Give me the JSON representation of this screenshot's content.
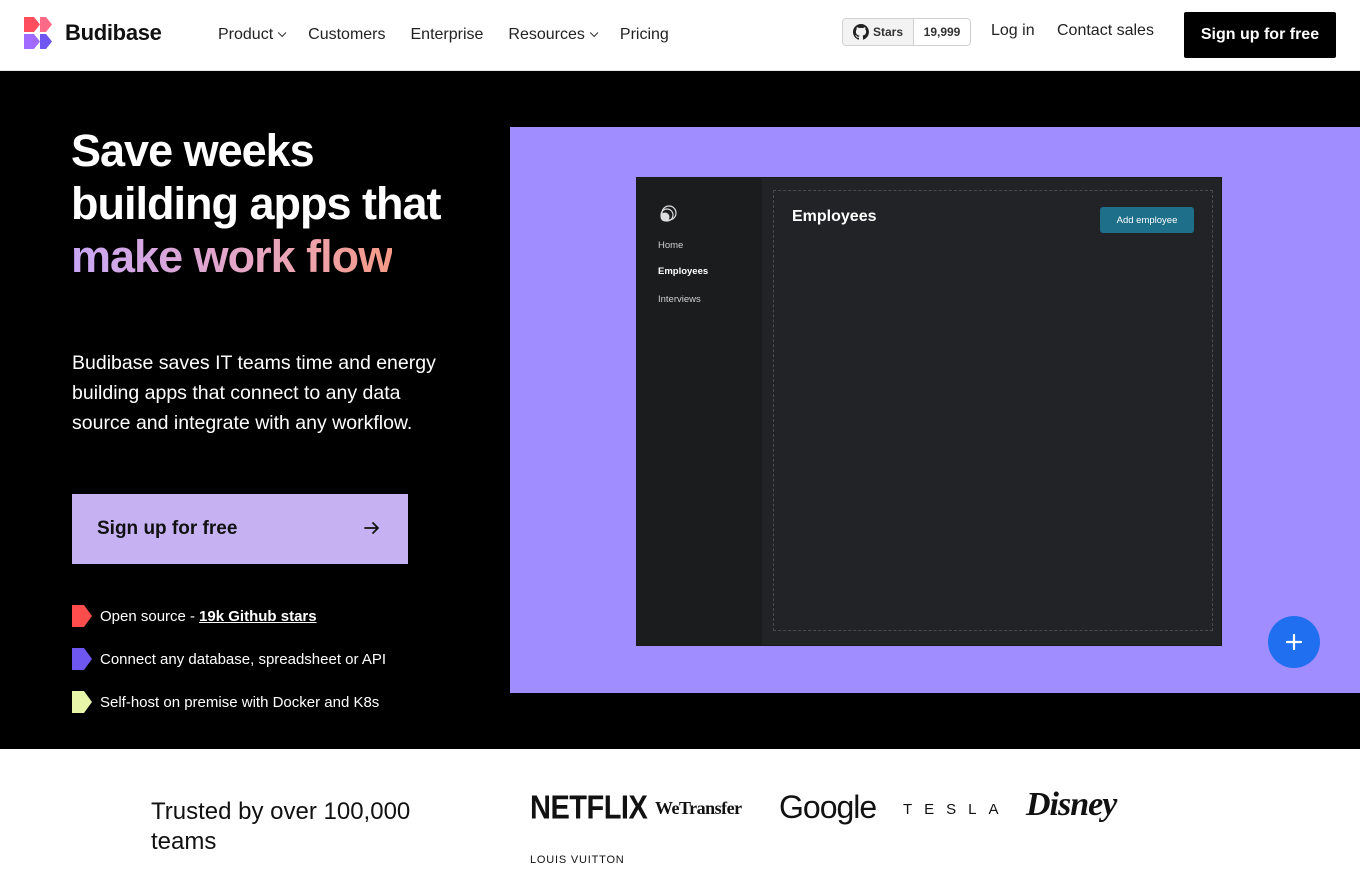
{
  "nav": {
    "brand": "Budibase",
    "links": [
      {
        "label": "Product",
        "dropdown": true
      },
      {
        "label": "Customers",
        "dropdown": false
      },
      {
        "label": "Enterprise",
        "dropdown": false
      },
      {
        "label": "Resources",
        "dropdown": true
      },
      {
        "label": "Pricing",
        "dropdown": false
      }
    ],
    "github_stars_label": "Stars",
    "github_stars_count": "19,999",
    "login": "Log in",
    "contact": "Contact sales",
    "signup": "Sign up for free"
  },
  "hero": {
    "title_plain": "Save weeks building apps that",
    "title_highlight": "make work flow",
    "subtitle": "Budibase saves IT teams time and energy building apps that connect to any data source and integrate with any workflow.",
    "cta": "Sign up for free",
    "features": [
      {
        "text": "Open source -",
        "link": "19k Github stars",
        "color": "#ff4d4d"
      },
      {
        "text": "Connect any database, spreadsheet or API",
        "link": "",
        "color": "#6e56f0"
      },
      {
        "text": "Self-host on premise with Docker and K8s",
        "link": "",
        "color": "#e6f5a8"
      }
    ]
  },
  "demo": {
    "sidebar": [
      "Home",
      "Employees",
      "Interviews"
    ],
    "active_item": "Employees",
    "screen_title": "Employees",
    "add_button": "Add employee",
    "fab": "+"
  },
  "trusted": {
    "heading": "Trusted by over 100,000 teams",
    "brands": [
      "NETFLIX",
      "WeTransfer",
      "Google",
      "TESLA",
      "Disney",
      "LOUIS VUITTON"
    ]
  },
  "colors": {
    "hero_bg": "#000000",
    "demo_bg": "#a08dff",
    "cta_bg": "#c6b2f2",
    "accent_blue": "#1f6ff0"
  }
}
